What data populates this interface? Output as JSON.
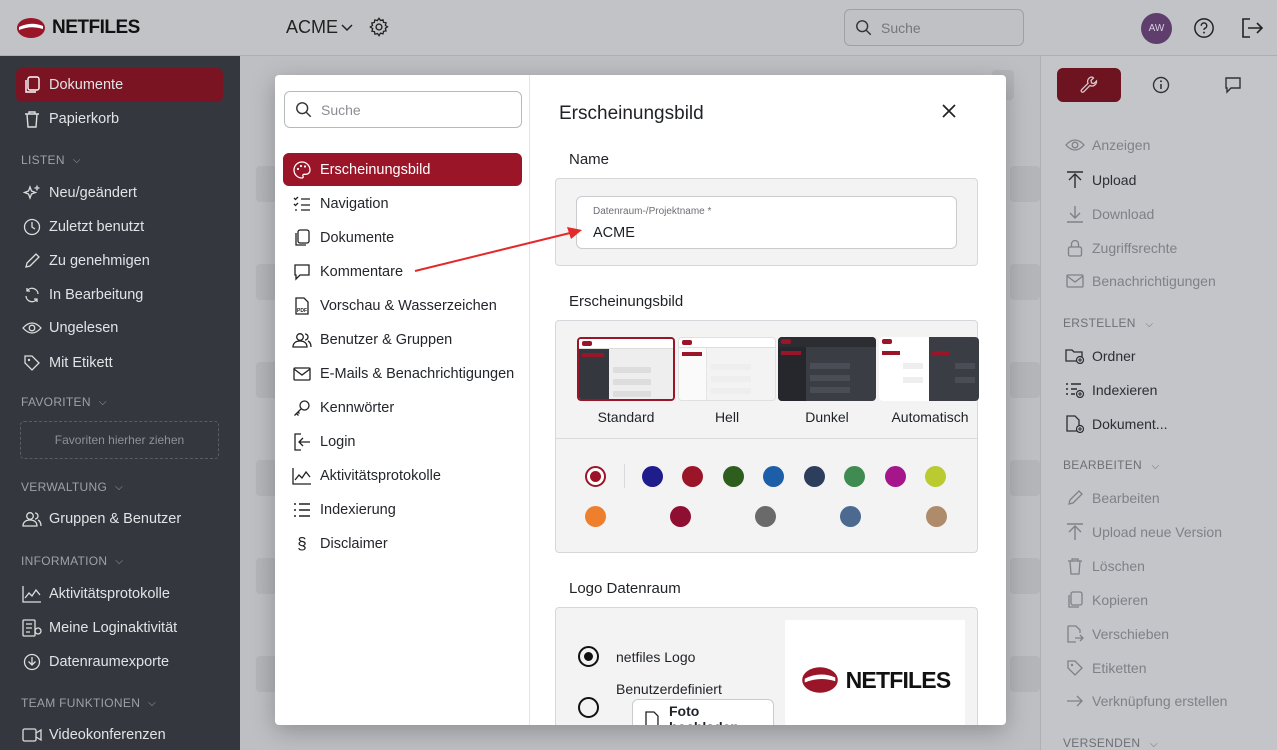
{
  "header": {
    "brand": "NETFILES",
    "workspace": "ACME",
    "search_placeholder": "Suche",
    "avatar_initials": "AW"
  },
  "sidebar": {
    "items": [
      {
        "label": "Dokumente",
        "icon": "documents-icon",
        "active": true
      },
      {
        "label": "Papierkorb",
        "icon": "trash-icon"
      }
    ],
    "listen_header": "LISTEN",
    "listen": [
      {
        "label": "Neu/geändert",
        "icon": "sparkle-icon"
      },
      {
        "label": "Zuletzt benutzt",
        "icon": "clock-icon"
      },
      {
        "label": "Zu genehmigen",
        "icon": "pencil-icon"
      },
      {
        "label": "In Bearbeitung",
        "icon": "refresh-icon"
      },
      {
        "label": "Ungelesen",
        "icon": "eye-icon"
      },
      {
        "label": "Mit Etikett",
        "icon": "tag-icon"
      }
    ],
    "favoriten_header": "FAVORITEN",
    "favoriten_drop": "Favoriten hierher ziehen",
    "verwaltung_header": "VERWALTUNG",
    "verwaltung": [
      {
        "label": "Gruppen & Benutzer",
        "icon": "users-icon"
      }
    ],
    "information_header": "INFORMATION",
    "information": [
      {
        "label": "Aktivitätsprotokolle",
        "icon": "activity-chart-icon"
      },
      {
        "label": "Meine Loginaktivität",
        "icon": "login-list-icon"
      },
      {
        "label": "Datenraumexporte",
        "icon": "download-circle-icon"
      }
    ],
    "team_header": "TEAM FUNKTIONEN",
    "team": [
      {
        "label": "Videokonferenzen",
        "icon": "video-icon"
      }
    ]
  },
  "right_panel": {
    "actions": [
      {
        "label": "Anzeigen",
        "enabled": false
      },
      {
        "label": "Upload",
        "enabled": true
      },
      {
        "label": "Download",
        "enabled": false
      },
      {
        "label": "Zugriffsrechte",
        "enabled": false
      },
      {
        "label": "Benachrichtigungen",
        "enabled": false
      }
    ],
    "erstellen_header": "ERSTELLEN",
    "erstellen": [
      {
        "label": "Ordner",
        "enabled": true
      },
      {
        "label": "Indexieren",
        "enabled": true
      },
      {
        "label": "Dokument...",
        "enabled": true
      }
    ],
    "bearbeiten_header": "BEARBEITEN",
    "bearbeiten": [
      {
        "label": "Bearbeiten",
        "enabled": false
      },
      {
        "label": "Upload neue Version",
        "enabled": false
      },
      {
        "label": "Löschen",
        "enabled": false
      },
      {
        "label": "Kopieren",
        "enabled": false
      },
      {
        "label": "Verschieben",
        "enabled": false
      },
      {
        "label": "Etiketten",
        "enabled": false
      },
      {
        "label": "Verknüpfung erstellen",
        "enabled": false
      }
    ],
    "versenden_header": "VERSENDEN"
  },
  "modal": {
    "search_placeholder": "Suche",
    "nav": [
      {
        "label": "Erscheinungsbild",
        "icon": "palette-icon",
        "active": true
      },
      {
        "label": "Navigation",
        "icon": "list-check-icon"
      },
      {
        "label": "Dokumente",
        "icon": "documents-icon"
      },
      {
        "label": "Kommentare",
        "icon": "comment-icon"
      },
      {
        "label": "Vorschau & Wasserzeichen",
        "icon": "pdf-icon"
      },
      {
        "label": "Benutzer & Gruppen",
        "icon": "users-icon"
      },
      {
        "label": "E-Mails & Benachrichtigungen",
        "icon": "mail-icon"
      },
      {
        "label": "Kennwörter",
        "icon": "key-icon"
      },
      {
        "label": "Login",
        "icon": "login-icon"
      },
      {
        "label": "Aktivitätsprotokolle",
        "icon": "activity-chart-icon"
      },
      {
        "label": "Indexierung",
        "icon": "list-icon"
      },
      {
        "label": "Disclaimer",
        "icon": "paragraph-icon"
      }
    ],
    "title": "Erscheinungsbild",
    "name_section": "Name",
    "name_field_label": "Datenraum-/Projektname *",
    "name_field_value": "ACME",
    "appearance_section": "Erscheinungsbild",
    "themes": [
      {
        "label": "Standard",
        "selected": true
      },
      {
        "label": "Hell"
      },
      {
        "label": "Dunkel"
      },
      {
        "label": "Automatisch"
      }
    ],
    "colors_row1": [
      "#9b1528",
      "#1f1c8c",
      "#9b1528",
      "#2e5e1e",
      "#1c5ea8",
      "#2d3e5d",
      "#3f8b52",
      "#a5168b",
      "#b9cb2e"
    ],
    "colors_row2": [
      "#ee7f2d",
      "#8f0f32",
      "#6a6a6a",
      "#4c6a8f",
      "#ad8b6b"
    ],
    "logo_section": "Logo Datenraum",
    "logo_options": [
      {
        "label": "netfiles Logo",
        "selected": true
      },
      {
        "label": "Benutzerdefiniert",
        "selected": false
      }
    ],
    "upload_button": "Foto hochladen",
    "logo_preview_text": "NETFILES"
  }
}
